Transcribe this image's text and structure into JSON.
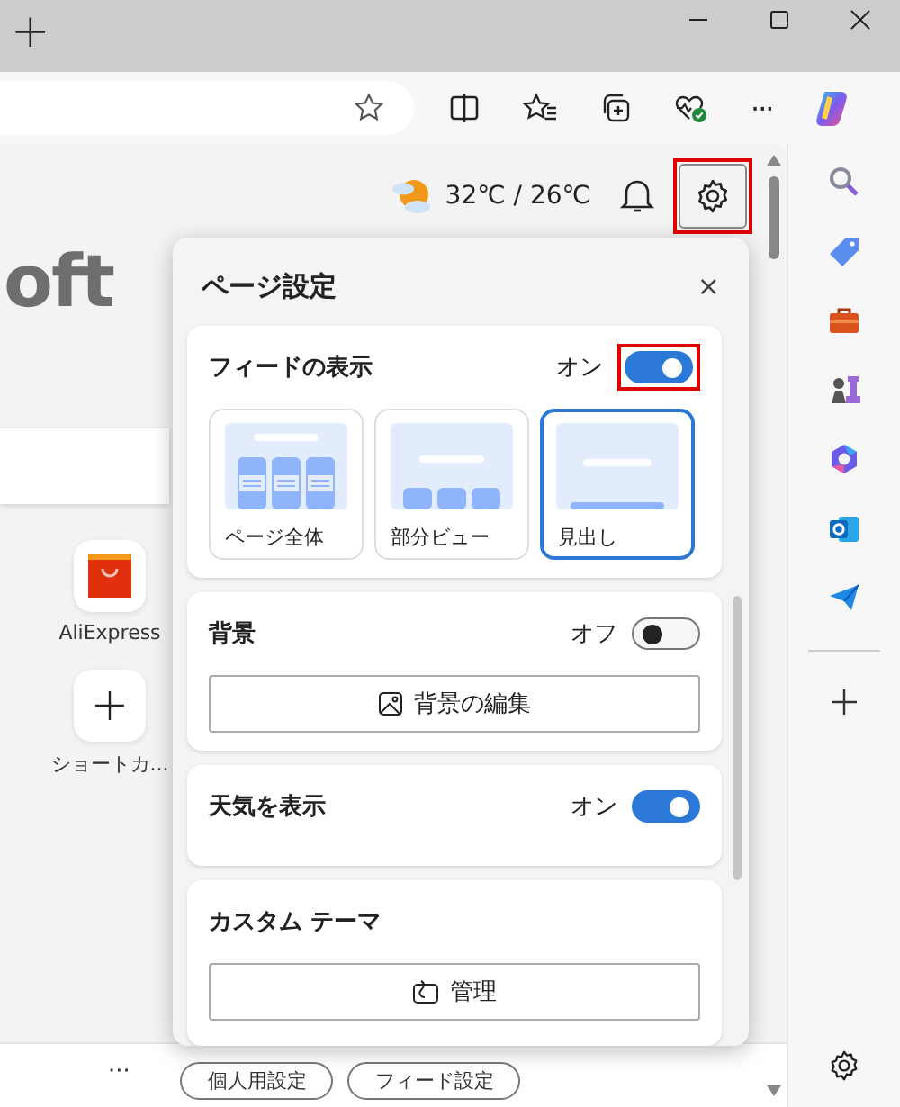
{
  "tab_bar": {
    "new_tab": "+"
  },
  "toolbar": {
    "more": "···"
  },
  "weather": {
    "temperature": "32℃ / 26℃"
  },
  "page": {
    "logo_fragment": "oft",
    "shortcuts": [
      {
        "label": "AliExpress",
        "kind": "app"
      },
      {
        "label": "ショートカ...",
        "kind": "add"
      }
    ],
    "bottom_more": "···",
    "bottom_buttons": [
      "個人用設定",
      "フィード設定"
    ]
  },
  "settings_panel": {
    "title": "ページ設定",
    "close": "×",
    "feed": {
      "label": "フィードの表示",
      "state_text": "オン",
      "on": true,
      "layouts": [
        {
          "label": "ページ全体",
          "kind": "full",
          "selected": false
        },
        {
          "label": "部分ビュー",
          "kind": "partial",
          "selected": false
        },
        {
          "label": "見出し",
          "kind": "headings",
          "selected": true
        }
      ]
    },
    "background": {
      "label": "背景",
      "state_text": "オフ",
      "on": false,
      "button": "背景の編集"
    },
    "weather": {
      "label": "天気を表示",
      "state_text": "オン",
      "on": true
    },
    "theme": {
      "label": "カスタム テーマ",
      "button": "管理"
    }
  }
}
